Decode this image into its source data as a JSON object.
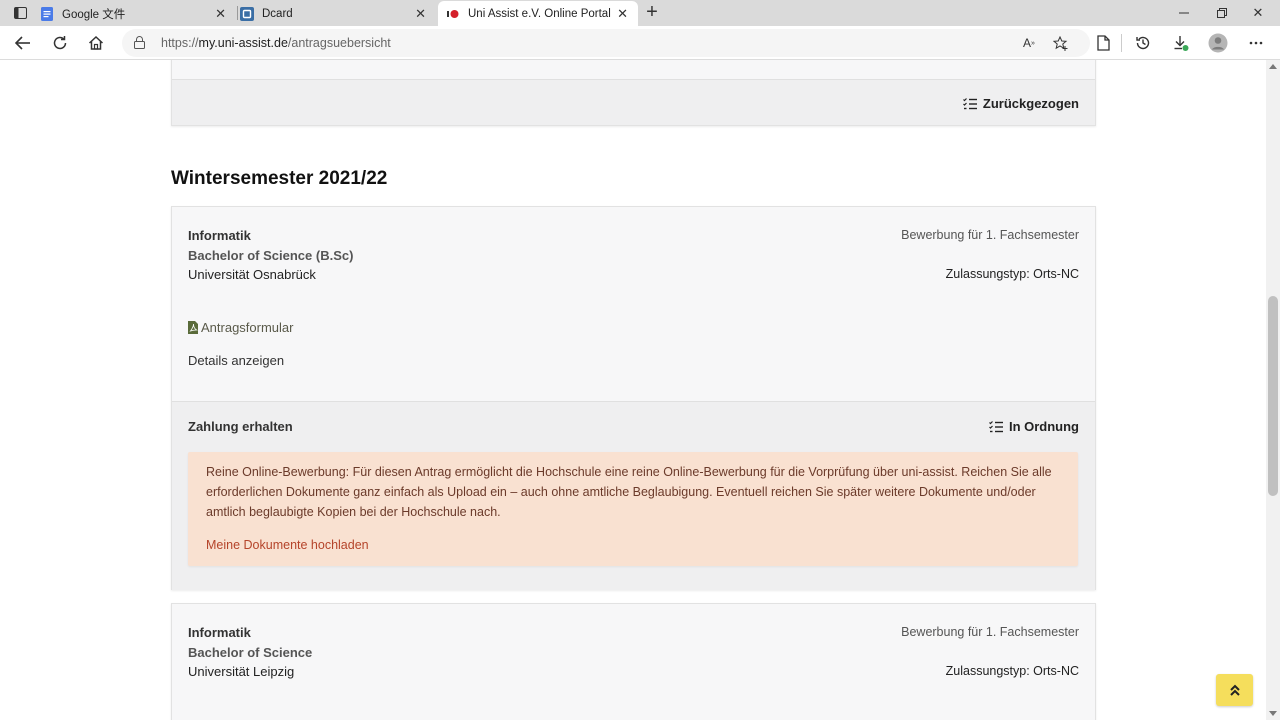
{
  "browser": {
    "tabs": [
      {
        "title": "Google 文件",
        "active": false
      },
      {
        "title": "Dcard",
        "active": false
      },
      {
        "title": "Uni Assist e.V. Online Portal",
        "active": true
      }
    ],
    "address": {
      "prefix": "https://",
      "host": "my.uni-assist.de",
      "path": "/antragsuebersicht"
    }
  },
  "page": {
    "previous_card": {
      "status": "Zurückgezogen"
    },
    "section_title": "Wintersemester 2021/22",
    "applications": [
      {
        "subject": "Informatik",
        "degree": "Bachelor of Science (B.Sc)",
        "university": "Universität Osnabrück",
        "application_type": "Bewerbung für 1. Fachsemester",
        "admission_type": "Zulassungstyp: Orts-NC",
        "form_link": "Antragsformular",
        "details_link": "Details anzeigen",
        "payment_label": "Zahlung erhalten",
        "status": "In Ordnung",
        "notice_text": "Reine Online-Bewerbung: Für diesen Antrag ermöglicht die Hochschule eine reine Online-Bewerbung für die Vorprüfung über uni-assist. Reichen Sie alle erforderlichen Dokumente ganz einfach als Upload ein – auch ohne amtliche Beglaubigung. Eventuell reichen Sie später weitere Dokumente und/oder amtlich beglaubigte Kopien bei der Hochschule nach.",
        "notice_link": "Meine Dokumente hochladen"
      },
      {
        "subject": "Informatik",
        "degree": "Bachelor of Science",
        "university": "Universität Leipzig",
        "application_type": "Bewerbung für 1. Fachsemester",
        "admission_type": "Zulassungstyp: Orts-NC"
      }
    ]
  },
  "colors": {
    "notice_bg": "#f9e1d1",
    "notice_link": "#b5442a",
    "scroll_top_bg": "#f5de5c"
  }
}
